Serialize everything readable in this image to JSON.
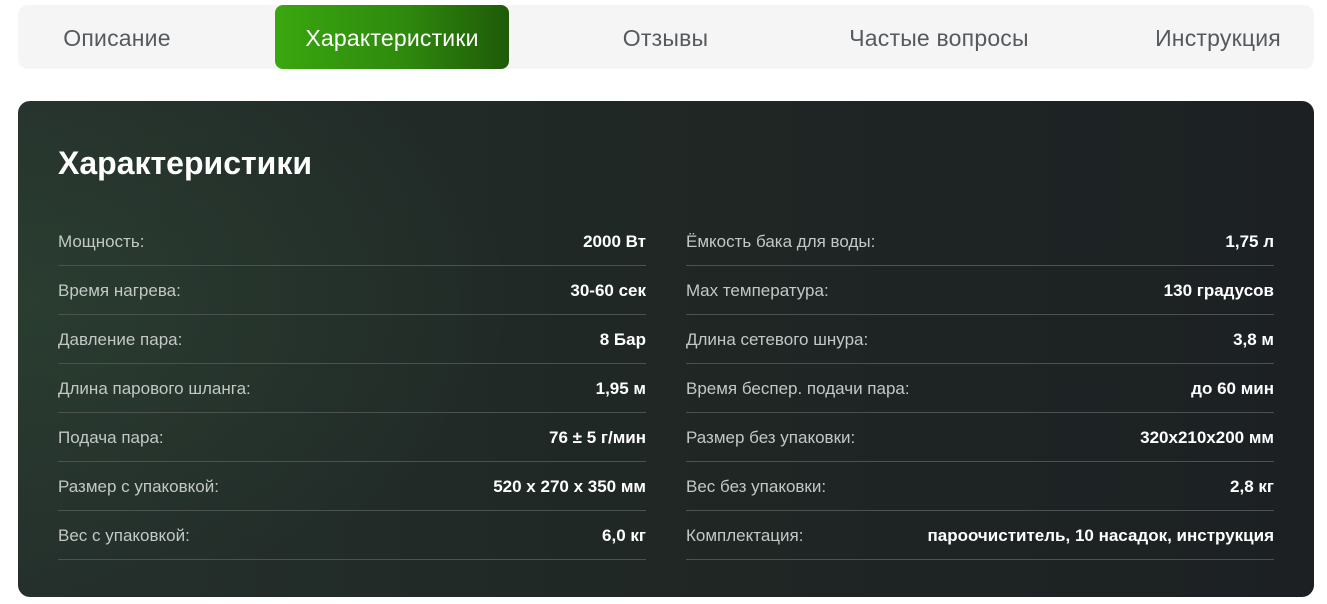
{
  "tabs": [
    {
      "label": "Описание"
    },
    {
      "label": "Характеристики"
    },
    {
      "label": "Отзывы"
    },
    {
      "label": "Частые вопросы"
    },
    {
      "label": "Инструкция"
    }
  ],
  "active_tab": "Характеристики",
  "panel": {
    "title": "Характеристики",
    "left": [
      {
        "label": "Мощность:",
        "value": "2000 Вт"
      },
      {
        "label": "Время нагрева:",
        "value": "30-60 сек"
      },
      {
        "label": "Давление пара:",
        "value": "8 Бар"
      },
      {
        "label": "Длина парового шланга:",
        "value": "1,95 м"
      },
      {
        "label": "Подача пара:",
        "value": "76 ± 5 г/мин"
      },
      {
        "label": "Размер с упаковкой:",
        "value": "520 x 270 x 350 мм"
      },
      {
        "label": "Вес с упаковкой:",
        "value": "6,0 кг"
      }
    ],
    "right": [
      {
        "label": "Ёмкость бака для воды:",
        "value": "1,75 л"
      },
      {
        "label": "Max температура:",
        "value": "130 градусов"
      },
      {
        "label": "Длина сетевого шнура:",
        "value": "3,8 м"
      },
      {
        "label": "Время беспер. подачи пара:",
        "value": "до 60 мин"
      },
      {
        "label": "Размер без упаковки:",
        "value": "320x210x200 мм"
      },
      {
        "label": "Вес без упаковки:",
        "value": "2,8 кг"
      },
      {
        "label": "Комплектация:",
        "value": "пароочиститель, 10 насадок, инструкция"
      }
    ]
  },
  "colors": {
    "accent": "#3aa70f",
    "accent_dark": "#1f5a08",
    "panel_bg": "#1f2624",
    "tab_bar_bg": "#f5f5f5"
  }
}
